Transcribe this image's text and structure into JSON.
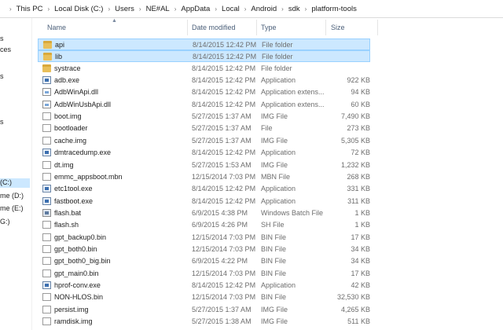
{
  "breadcrumb": [
    "This PC",
    "Local Disk (C:)",
    "Users",
    "NE#AL",
    "AppData",
    "Local",
    "Android",
    "sdk",
    "platform-tools"
  ],
  "nav": {
    "items": [
      {
        "label": "s",
        "selected": false
      },
      {
        "label": "ces",
        "selected": false
      },
      {
        "label": "s",
        "selected": false
      },
      {
        "label": "s",
        "selected": false
      },
      {
        "label": "(C:)",
        "selected": true
      },
      {
        "label": "me (D:)",
        "selected": false
      },
      {
        "label": "me (E:)",
        "selected": false
      },
      {
        "label": "G:)",
        "selected": false
      }
    ]
  },
  "columns": {
    "name": "Name",
    "date": "Date modified",
    "type": "Type",
    "size": "Size"
  },
  "files": [
    {
      "name": "api",
      "date": "8/14/2015 12:42 PM",
      "type": "File folder",
      "size": "",
      "icon": "folder-icon",
      "selected": true
    },
    {
      "name": "lib",
      "date": "8/14/2015 12:42 PM",
      "type": "File folder",
      "size": "",
      "icon": "folder-icon",
      "selected": true
    },
    {
      "name": "systrace",
      "date": "8/14/2015 12:42 PM",
      "type": "File folder",
      "size": "",
      "icon": "folder-icon",
      "selected": false
    },
    {
      "name": "adb.exe",
      "date": "8/14/2015 12:42 PM",
      "type": "Application",
      "size": "922 KB",
      "icon": "application-icon",
      "selected": false
    },
    {
      "name": "AdbWinApi.dll",
      "date": "8/14/2015 12:42 PM",
      "type": "Application extens...",
      "size": "94 KB",
      "icon": "dll-icon",
      "selected": false
    },
    {
      "name": "AdbWinUsbApi.dll",
      "date": "8/14/2015 12:42 PM",
      "type": "Application extens...",
      "size": "60 KB",
      "icon": "dll-icon",
      "selected": false
    },
    {
      "name": "boot.img",
      "date": "5/27/2015 1:37 AM",
      "type": "IMG File",
      "size": "7,490 KB",
      "icon": "file-icon",
      "selected": false
    },
    {
      "name": "bootloader",
      "date": "5/27/2015 1:37 AM",
      "type": "File",
      "size": "273 KB",
      "icon": "file-icon",
      "selected": false
    },
    {
      "name": "cache.img",
      "date": "5/27/2015 1:37 AM",
      "type": "IMG File",
      "size": "5,305 KB",
      "icon": "file-icon",
      "selected": false
    },
    {
      "name": "dmtracedump.exe",
      "date": "8/14/2015 12:42 PM",
      "type": "Application",
      "size": "72 KB",
      "icon": "application-icon",
      "selected": false
    },
    {
      "name": "dt.img",
      "date": "5/27/2015 1:53 AM",
      "type": "IMG File",
      "size": "1,232 KB",
      "icon": "file-icon",
      "selected": false
    },
    {
      "name": "emmc_appsboot.mbn",
      "date": "12/15/2014 7:03 PM",
      "type": "MBN File",
      "size": "268 KB",
      "icon": "file-icon",
      "selected": false
    },
    {
      "name": "etc1tool.exe",
      "date": "8/14/2015 12:42 PM",
      "type": "Application",
      "size": "331 KB",
      "icon": "application-icon",
      "selected": false
    },
    {
      "name": "fastboot.exe",
      "date": "8/14/2015 12:42 PM",
      "type": "Application",
      "size": "311 KB",
      "icon": "application-icon",
      "selected": false
    },
    {
      "name": "flash.bat",
      "date": "6/9/2015 4:38 PM",
      "type": "Windows Batch File",
      "size": "1 KB",
      "icon": "batch-file-icon",
      "selected": false
    },
    {
      "name": "flash.sh",
      "date": "6/9/2015 4:26 PM",
      "type": "SH File",
      "size": "1 KB",
      "icon": "file-icon",
      "selected": false
    },
    {
      "name": "gpt_backup0.bin",
      "date": "12/15/2014 7:03 PM",
      "type": "BIN File",
      "size": "17 KB",
      "icon": "file-icon",
      "selected": false
    },
    {
      "name": "gpt_both0.bin",
      "date": "12/15/2014 7:03 PM",
      "type": "BIN File",
      "size": "34 KB",
      "icon": "file-icon",
      "selected": false
    },
    {
      "name": "gpt_both0_big.bin",
      "date": "6/9/2015 4:22 PM",
      "type": "BIN File",
      "size": "34 KB",
      "icon": "file-icon",
      "selected": false
    },
    {
      "name": "gpt_main0.bin",
      "date": "12/15/2014 7:03 PM",
      "type": "BIN File",
      "size": "17 KB",
      "icon": "file-icon",
      "selected": false
    },
    {
      "name": "hprof-conv.exe",
      "date": "8/14/2015 12:42 PM",
      "type": "Application",
      "size": "42 KB",
      "icon": "application-icon",
      "selected": false
    },
    {
      "name": "NON-HLOS.bin",
      "date": "12/15/2014 7:03 PM",
      "type": "BIN File",
      "size": "32,530 KB",
      "icon": "file-icon",
      "selected": false
    },
    {
      "name": "persist.img",
      "date": "5/27/2015 1:37 AM",
      "type": "IMG File",
      "size": "4,265 KB",
      "icon": "file-icon",
      "selected": false
    },
    {
      "name": "ramdisk.img",
      "date": "5/27/2015 1:38 AM",
      "type": "IMG File",
      "size": "511 KB",
      "icon": "file-icon",
      "selected": false
    }
  ]
}
